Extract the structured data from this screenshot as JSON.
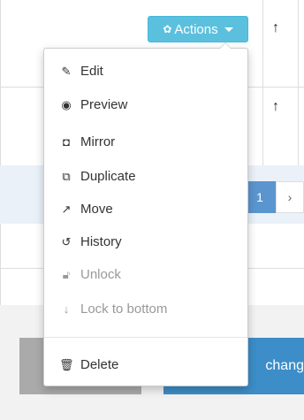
{
  "actions_button": {
    "label": "Actions",
    "icon": "gear-icon",
    "color": "#5bc0de"
  },
  "table": {
    "move_up_icon": "↑"
  },
  "pagination": {
    "active_page": "1",
    "next_icon": "›"
  },
  "footer": {
    "save_label": "chang"
  },
  "menu": {
    "items": [
      {
        "label": "Edit",
        "icon": "edit-icon",
        "disabled": false
      },
      {
        "label": "Preview",
        "icon": "eye-icon",
        "disabled": false
      },
      {
        "label": "Mirror",
        "icon": "mirror-icon",
        "disabled": false
      },
      {
        "label": "Duplicate",
        "icon": "duplicate-icon",
        "disabled": false
      },
      {
        "label": "Move",
        "icon": "external-link-icon",
        "disabled": false
      },
      {
        "label": "History",
        "icon": "history-icon",
        "disabled": false
      },
      {
        "label": "Unlock",
        "icon": "lock-icon",
        "disabled": true
      },
      {
        "label": "Lock to bottom",
        "icon": "arrow-down-icon",
        "disabled": true
      },
      {
        "label": "Delete",
        "icon": "trash-icon",
        "disabled": false
      }
    ]
  },
  "colors": {
    "accent": "#5bc0de",
    "primary": "#3c8dc8",
    "pagination_active": "#5a95cf",
    "disabled_text": "#999999"
  }
}
